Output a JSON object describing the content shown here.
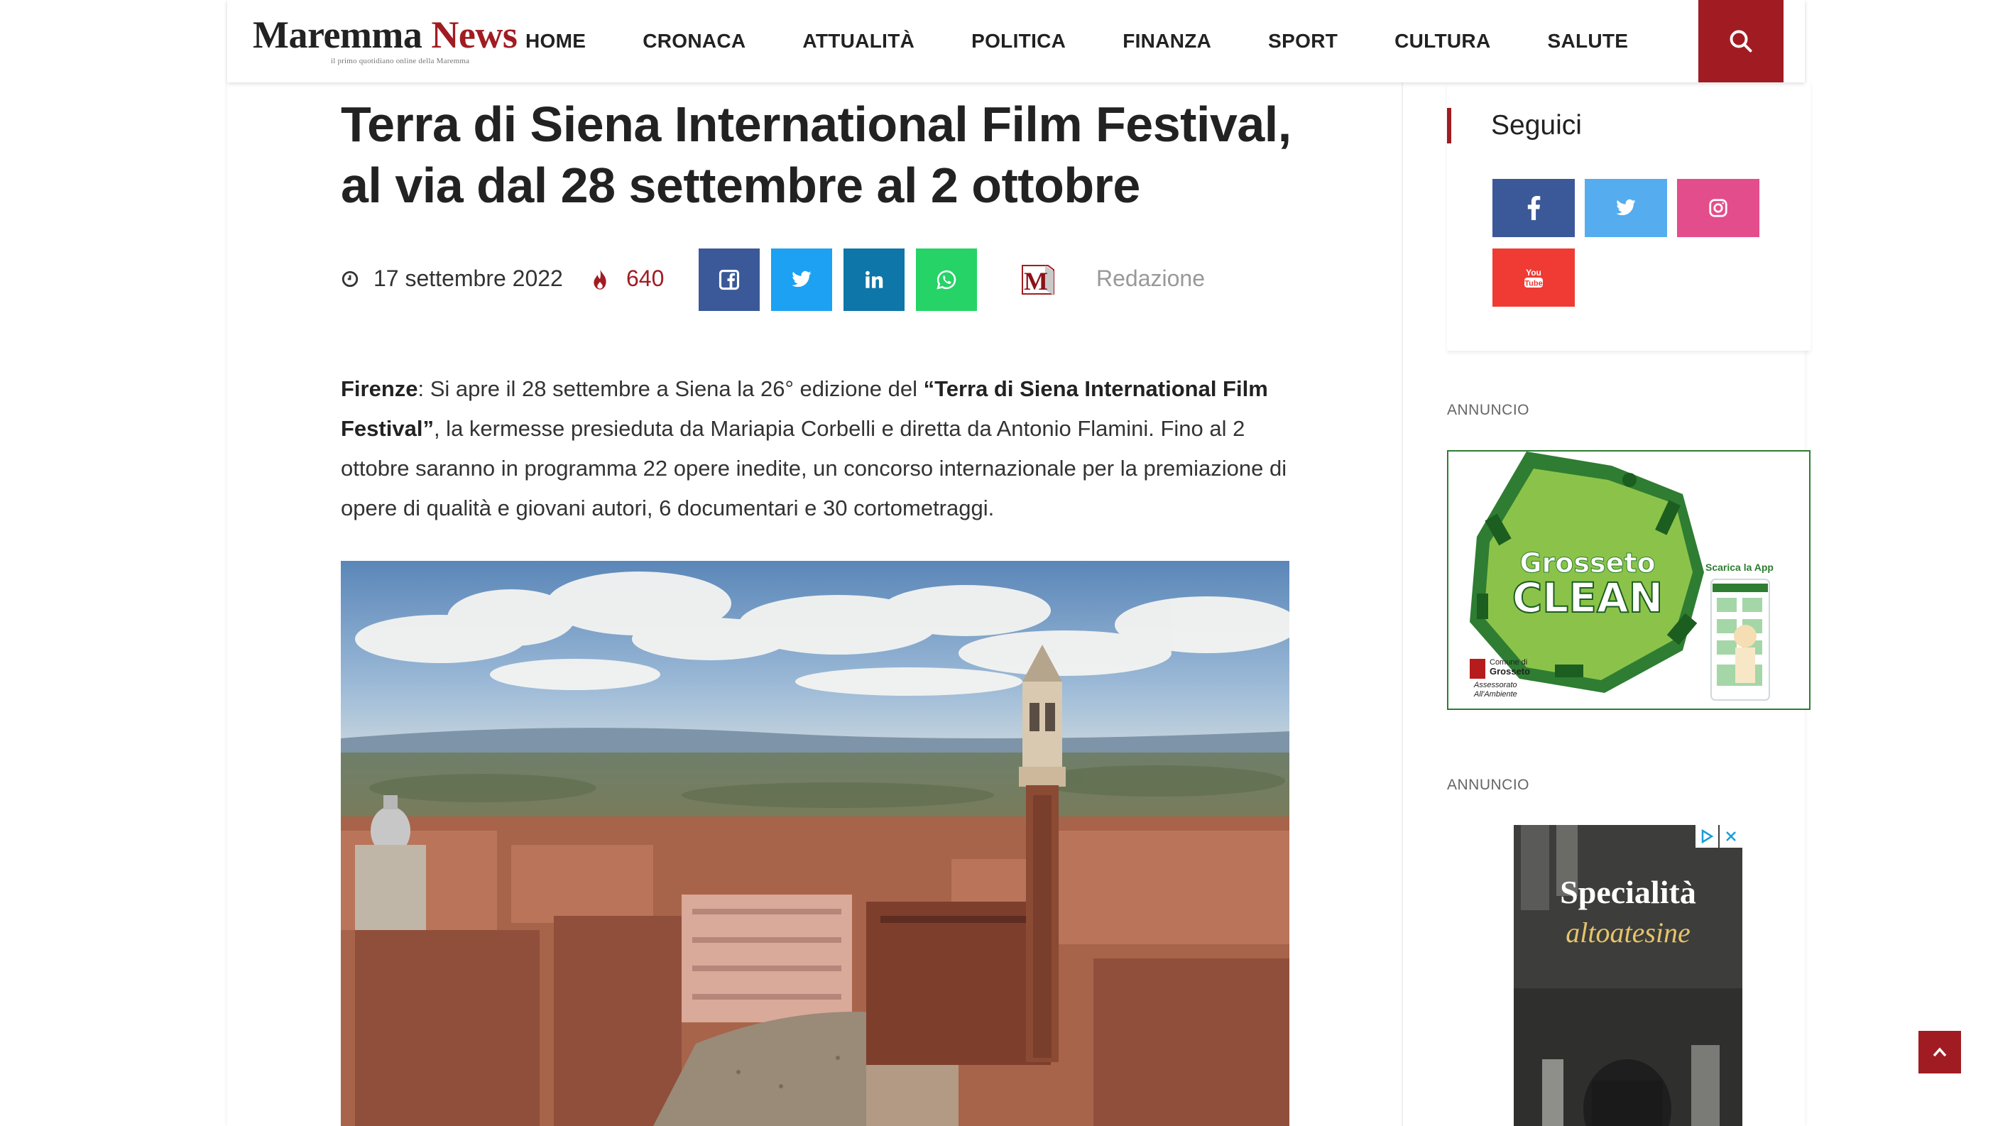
{
  "header": {
    "logo_main": "Maremma",
    "logo_accent": "News",
    "logo_tagline": "il primo quotidiano online della Maremma",
    "nav": [
      "HOME",
      "CRONACA",
      "ATTUALITÀ",
      "POLITICA",
      "FINANZA",
      "SPORT",
      "CULTURA",
      "SALUTE"
    ],
    "search_icon": "search-icon"
  },
  "article": {
    "title": "Terra di Siena International Film Festival, al via dal 28 settembre al 2 ottobre",
    "date": "17 settembre 2022",
    "views": "640",
    "author": "Redazione",
    "share_icons": [
      "facebook-icon",
      "twitter-icon",
      "linkedin-icon",
      "whatsapp-icon"
    ],
    "body": {
      "location": "Firenze",
      "part1": ": Si apre il 28 settembre a Siena la 26° edizione del ",
      "festival": "“Terra di Siena International Film Festival”",
      "part2": ", la kermesse presieduta da Mariapia Corbelli e diretta da Antonio Flamini. Fino al 2 ottobre saranno in programma 22 opere inedite, un concorso internazionale per la premiazione di opere di qualità e giovani autori, 6 documentari e 30 cortometraggi."
    }
  },
  "sidebar": {
    "follow_title": "Seguici",
    "social_icons": [
      "facebook-icon",
      "twitter-icon",
      "instagram-icon",
      "youtube-icon"
    ],
    "ad_label_1": "ANNUNCIO",
    "ad_label_2": "ANNUNCIO",
    "ad1": {
      "brand": "Grosseto",
      "brand2": "CLEAN",
      "app_cta": "Scarica la App",
      "org1": "Comune di",
      "org2": "Grosseto",
      "org3": "Assessorato",
      "org4": "All'Ambiente"
    },
    "ad2": {
      "title": "Specialità",
      "subtitle": "altoatesine"
    }
  },
  "colors": {
    "brand": "#a11c22",
    "facebook": "#3b5998",
    "twitter": "#1da1f2",
    "linkedin": "#0e76a8",
    "whatsapp": "#25d366",
    "instagram": "#e44d8c",
    "youtube": "#ef3b33"
  }
}
